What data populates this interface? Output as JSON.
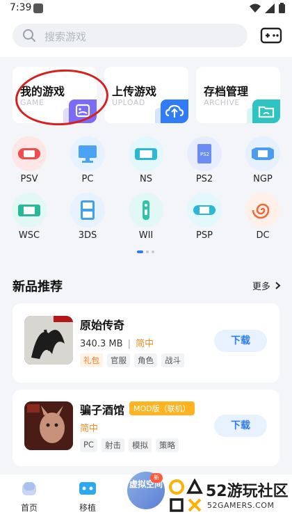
{
  "status_bar": {
    "time": "7:39"
  },
  "search": {
    "placeholder": "搜索游戏"
  },
  "quick_actions": [
    {
      "title": "我的游戏",
      "subtitle": "GAME",
      "icon": "gamepad-card-icon",
      "color": "#7b6cf6"
    },
    {
      "title": "上传游戏",
      "subtitle": "UPLOAD",
      "icon": "cloud-upload-icon",
      "color": "#2f7cf6"
    },
    {
      "title": "存档管理",
      "subtitle": "ARCHIVE",
      "icon": "folder-icon",
      "color": "#2fc4c4"
    }
  ],
  "platforms": [
    {
      "label": "PSV",
      "icon": "psv-console-icon",
      "bg": "#ffe6e6",
      "color": "#f04c4c"
    },
    {
      "label": "PC",
      "icon": "pc-monitor-icon",
      "bg": "#e6f2ff",
      "color": "#4aa3f5"
    },
    {
      "label": "NS",
      "icon": "switch-console-icon",
      "bg": "#e3f8fc",
      "color": "#2bb8d8"
    },
    {
      "label": "PS2",
      "icon": "ps2-console-icon",
      "bg": "#e8ecff",
      "color": "#6b8cf2"
    },
    {
      "label": "NGP",
      "icon": "ngp-console-icon",
      "bg": "#e6f1ff",
      "color": "#4a9cf0"
    },
    {
      "label": "WSC",
      "icon": "wsc-console-icon",
      "bg": "#e2f8f3",
      "color": "#2ab89a"
    },
    {
      "label": "3DS",
      "icon": "3ds-console-icon",
      "bg": "#e6f2ff",
      "color": "#3fa0f0"
    },
    {
      "label": "WII",
      "icon": "wii-remote-icon",
      "bg": "#e2f8f4",
      "color": "#2fc4a8"
    },
    {
      "label": "PSP",
      "icon": "psp-console-icon",
      "bg": "#e3f8fc",
      "color": "#2bb8d8"
    },
    {
      "label": "DC",
      "icon": "dc-swirl-icon",
      "bg": "#fff0ea",
      "color": "#f06a3a"
    }
  ],
  "new_section": {
    "title": "新品推荐",
    "more": "更多"
  },
  "games": [
    {
      "name": "原始传奇",
      "size": "340.3 MB",
      "lang": "简中",
      "tags": [
        "礼包",
        "官服",
        "角色",
        "战斗"
      ],
      "download": "下载",
      "badge": ""
    },
    {
      "name": "骗子酒馆",
      "size": "",
      "lang": "简中",
      "tags": [
        "PC",
        "射击",
        "模拟",
        "策略"
      ],
      "download": "下载",
      "badge": "MOD版（联机）"
    }
  ],
  "bottom_nav": {
    "home": "首页",
    "port": "移植",
    "center": "虚拟空间"
  },
  "watermark": {
    "brand": "52游玩社区",
    "url": "52GAMERS.COM"
  }
}
